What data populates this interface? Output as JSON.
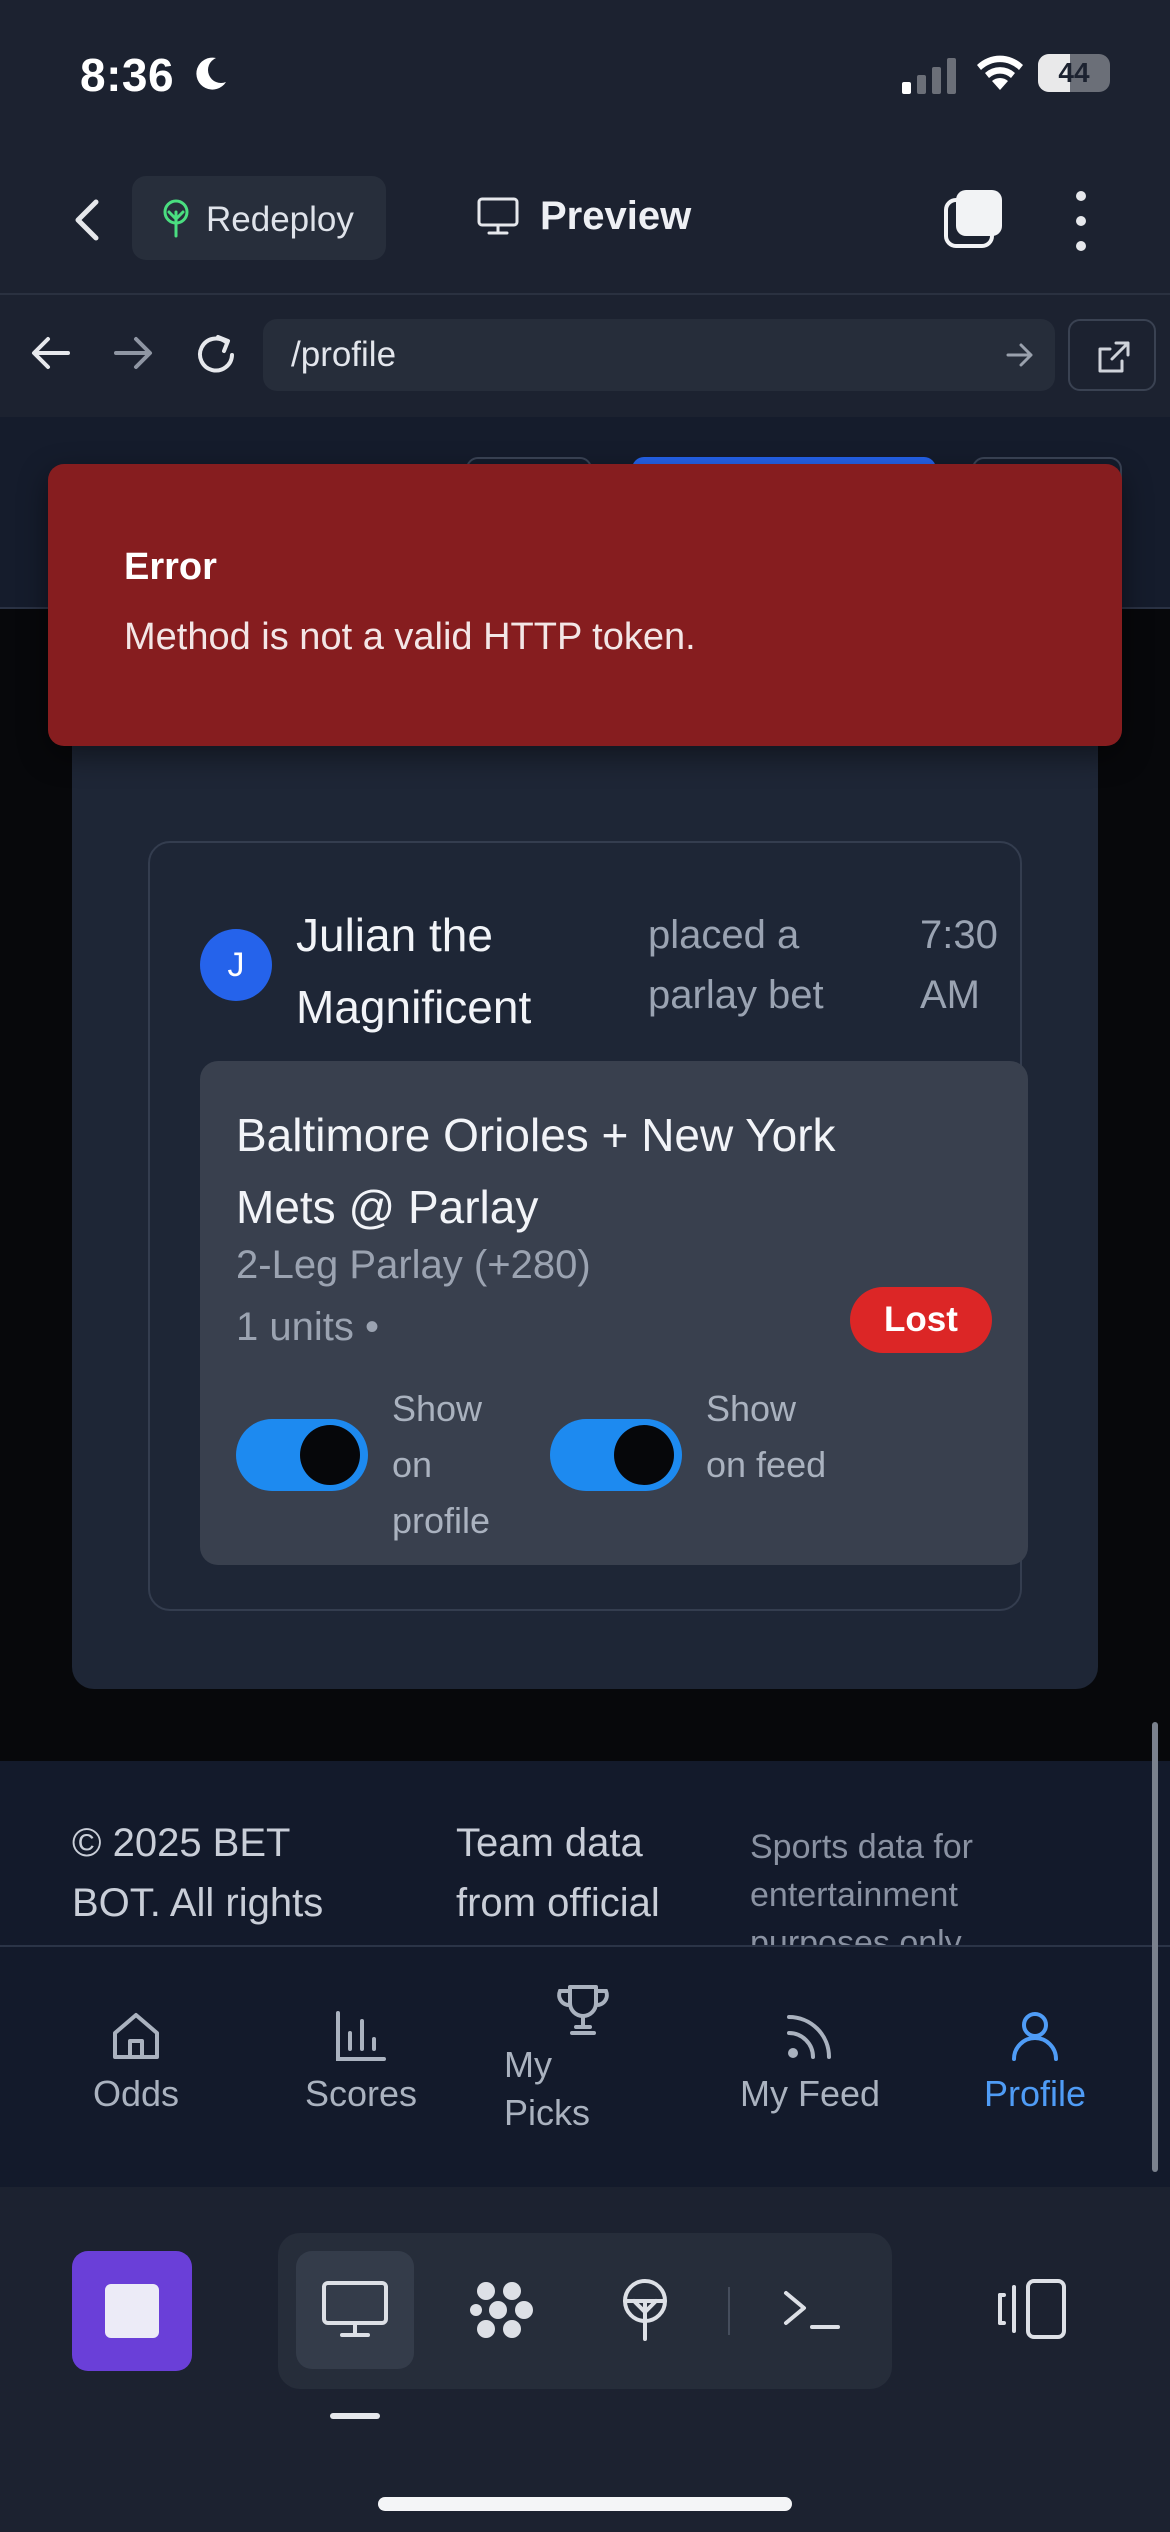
{
  "status": {
    "time": "8:36",
    "battery": "44",
    "battery_level": 0.44
  },
  "header": {
    "redeploy_label": "Redeploy",
    "preview_label": "Preview"
  },
  "urlbar": {
    "url": "/profile"
  },
  "error_toast": {
    "title": "Error",
    "message": "Method is not a valid HTTP token."
  },
  "activity": {
    "avatar_initial": "J",
    "user_name": "Julian the Magnificent",
    "action": "placed a parlay bet",
    "time": "7:30 AM",
    "bet": {
      "title": "Baltimore Orioles + New York Mets @ Parlay",
      "subtitle": "2-Leg Parlay (+280)",
      "units": "1 units •",
      "status": "Lost",
      "toggles": [
        {
          "label": "Show on profile",
          "on": true
        },
        {
          "label": "Show on feed",
          "on": true
        }
      ]
    }
  },
  "footer": {
    "copyright": "© 2025 BET BOT. All rights",
    "team_data": "Team data from official",
    "sports_data": "Sports data for entertainment purposes only"
  },
  "bottom_nav": [
    {
      "label": "Odds",
      "icon": "home-icon",
      "active": false
    },
    {
      "label": "Scores",
      "icon": "bar-chart-icon",
      "active": false
    },
    {
      "label": "My Picks",
      "icon": "trophy-icon",
      "active": false
    },
    {
      "label": "My Feed",
      "icon": "rss-icon",
      "active": false
    },
    {
      "label": "Profile",
      "icon": "user-icon",
      "active": true
    }
  ],
  "colors": {
    "accent": "#4f9cf6",
    "error": "#861d1f",
    "lost": "#dc2626",
    "toggle_on": "#1d8af0",
    "stop": "#6a3fd8"
  }
}
